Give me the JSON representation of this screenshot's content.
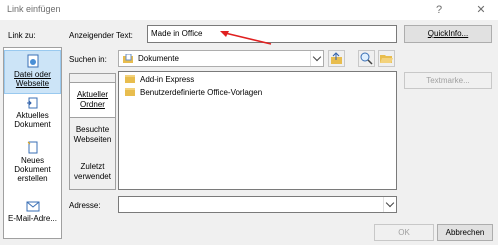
{
  "window": {
    "title": "Link einfügen",
    "help": "?",
    "close": "✕"
  },
  "link_to": {
    "label": "Link zu:",
    "items": [
      {
        "label": "Datei oder Webseite",
        "icon": "globe-page-icon",
        "selected": true
      },
      {
        "label": "Aktuelles Dokument",
        "icon": "document-arrow-icon",
        "selected": false
      },
      {
        "label": "Neues Dokument erstellen",
        "icon": "new-document-icon",
        "selected": false
      },
      {
        "label": "E-Mail-Adre...",
        "icon": "email-icon",
        "selected": false
      }
    ]
  },
  "display_text": {
    "label": "Anzeigender Text:",
    "value": "Made in Office"
  },
  "quickinfo_button": "QuickInfo...",
  "look_in": {
    "label": "Suchen in:",
    "value": "Dokumente"
  },
  "look_in_tabs": [
    {
      "label": "Aktueller Ordner",
      "selected": true
    },
    {
      "label": "Besuchte Webseiten",
      "selected": false
    },
    {
      "label": "Zuletzt verwendet",
      "selected": false
    }
  ],
  "files": [
    {
      "name": "Add-in Express",
      "icon": "folder-icon"
    },
    {
      "name": "Benutzerdefinierte Office-Vorlagen",
      "icon": "folder-icon"
    }
  ],
  "textmarke_button": "Textmarke...",
  "address": {
    "label": "Adresse:",
    "value": ""
  },
  "ok_button": "OK",
  "cancel_button": "Abbrechen",
  "colors": {
    "annotation_arrow": "#e02020",
    "selection": "#cce4f7"
  }
}
